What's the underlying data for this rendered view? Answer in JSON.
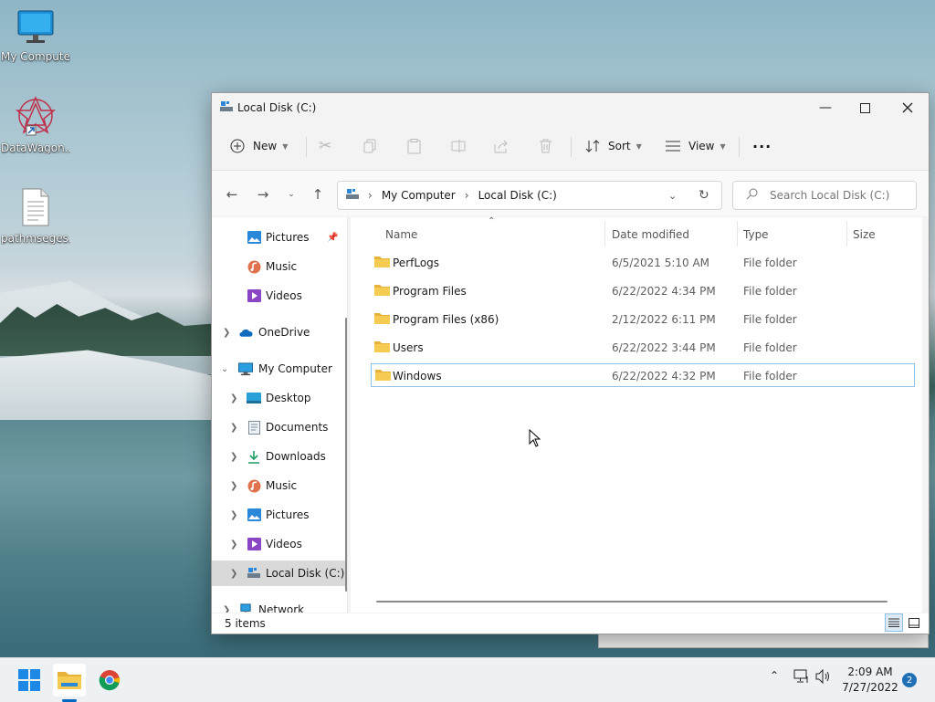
{
  "desktop": {
    "icons": [
      {
        "label": "My Computer"
      },
      {
        "label": "DataWagon..."
      },
      {
        "label": "pathmseges..."
      }
    ]
  },
  "window": {
    "title": "Local Disk (C:)",
    "toolbar": {
      "new_label": "New",
      "sort_label": "Sort",
      "view_label": "View",
      "more_label": "···"
    },
    "address": {
      "crumbs": [
        "My Computer",
        "Local Disk (C:)"
      ],
      "search_placeholder": "Search Local Disk (C:)"
    },
    "nav": {
      "items": [
        {
          "label": "Pictures"
        },
        {
          "label": "Music"
        },
        {
          "label": "Videos"
        },
        {
          "label": "OneDrive"
        },
        {
          "label": "My Computer"
        },
        {
          "label": "Desktop"
        },
        {
          "label": "Documents"
        },
        {
          "label": "Downloads"
        },
        {
          "label": "Music"
        },
        {
          "label": "Pictures"
        },
        {
          "label": "Videos"
        },
        {
          "label": "Local Disk (C:)"
        },
        {
          "label": "Network"
        }
      ]
    },
    "columns": {
      "name": "Name",
      "date": "Date modified",
      "type": "Type",
      "size": "Size"
    },
    "rows": [
      {
        "name": "PerfLogs",
        "date": "6/5/2021 5:10 AM",
        "type": "File folder"
      },
      {
        "name": "Program Files",
        "date": "6/22/2022 4:34 PM",
        "type": "File folder"
      },
      {
        "name": "Program Files (x86)",
        "date": "2/12/2022 6:11 PM",
        "type": "File folder"
      },
      {
        "name": "Users",
        "date": "6/22/2022 3:44 PM",
        "type": "File folder"
      },
      {
        "name": "Windows",
        "date": "6/22/2022 4:32 PM",
        "type": "File folder"
      }
    ],
    "status": {
      "count": "5 items"
    }
  },
  "taskbar": {
    "time": "2:09 AM",
    "date": "7/27/2022",
    "notifications": "2"
  },
  "colors": {
    "accent": "#0067c0",
    "folder": "#f4c542",
    "selection": "#8fc1e6"
  }
}
